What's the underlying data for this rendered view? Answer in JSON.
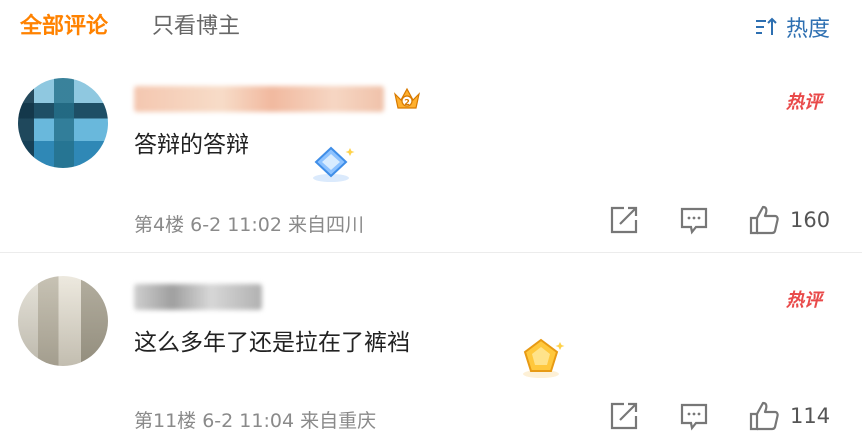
{
  "tabs": {
    "all": "全部评论",
    "owner_only": "只看博主",
    "sort_label": "热度"
  },
  "comments": [
    {
      "text": "答辩的答辩",
      "meta": "第4楼 6-2 11:02 来自四川",
      "hot": "热评",
      "likes": "160"
    },
    {
      "text": "这么多年了还是拉在了裤裆",
      "meta": "第11楼 6-2 11:04 来自重庆",
      "hot": "热评",
      "likes": "114"
    }
  ],
  "colors": {
    "accent": "#ff8200",
    "link": "#2d6fb1",
    "hot": "#e94a4a",
    "meta": "#8a8a8a"
  }
}
